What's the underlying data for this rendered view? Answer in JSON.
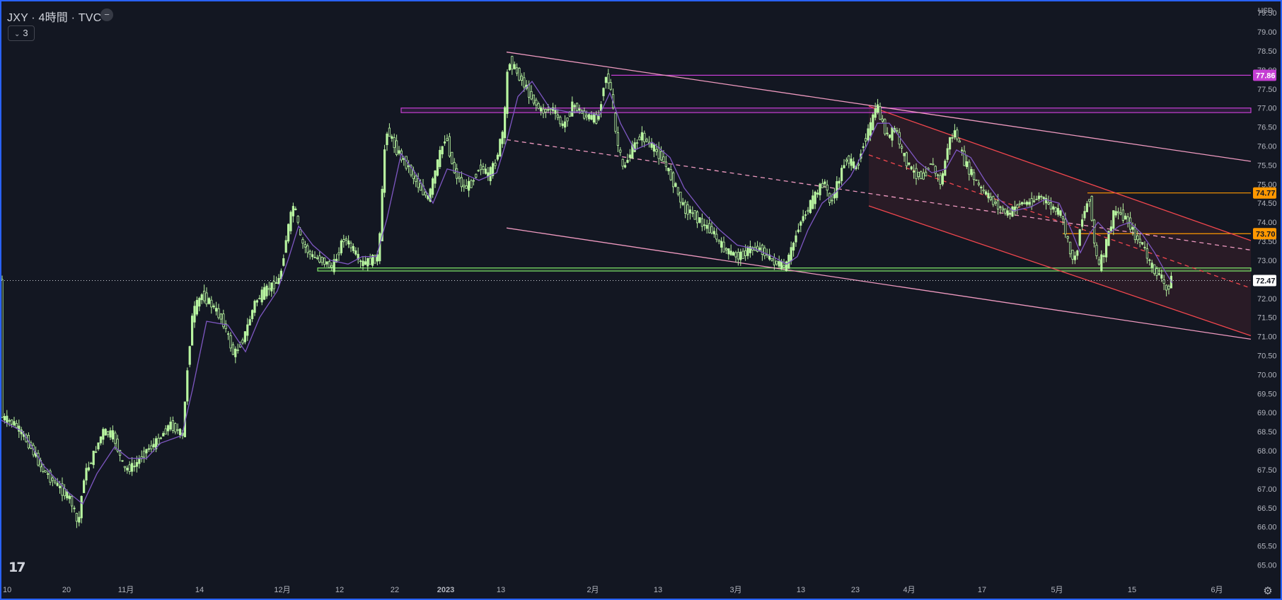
{
  "legend": {
    "title": "JXY · 4時間 · TVC",
    "toggle_icon": "minus-icon",
    "indicator_count": "3"
  },
  "currency": "USD",
  "colors": {
    "background": "#131722",
    "up": "#b8f5a0",
    "down": "#b8f5a0",
    "ma": "#7e57c2",
    "channel_outer": "#ef9ac0",
    "channel_red": "#f0464d",
    "resistance": "#c53ed3",
    "support": "#7be067",
    "level_orange": "#ff9800"
  },
  "chart_data": {
    "type": "candlestick",
    "title": "",
    "xlabel": "",
    "ylabel": "",
    "ylim": [
      64.6,
      79.8
    ],
    "y_ticks": [
      "79.50",
      "79.00",
      "78.50",
      "78.00",
      "77.50",
      "77.00",
      "76.50",
      "76.00",
      "75.50",
      "75.00",
      "74.50",
      "74.00",
      "73.50",
      "73.00",
      "72.50",
      "72.00",
      "71.50",
      "71.00",
      "70.50",
      "70.00",
      "69.50",
      "69.00",
      "68.50",
      "68.00",
      "67.50",
      "67.00",
      "66.50",
      "66.00",
      "65.50",
      "65.00"
    ],
    "x_ticks": [
      {
        "label": "10",
        "t": 2
      },
      {
        "label": "20",
        "t": 92
      },
      {
        "label": "11月",
        "t": 176
      },
      {
        "label": "14",
        "t": 280
      },
      {
        "label": "12月",
        "t": 397
      },
      {
        "label": "12",
        "t": 478
      },
      {
        "label": "22",
        "t": 556
      },
      {
        "label": "2023",
        "t": 628
      },
      {
        "label": "13",
        "t": 706
      },
      {
        "label": "2月",
        "t": 836
      },
      {
        "label": "13",
        "t": 928
      },
      {
        "label": "3月",
        "t": 1038
      },
      {
        "label": "13",
        "t": 1130
      },
      {
        "label": "23",
        "t": 1207
      },
      {
        "label": "4月",
        "t": 1283
      },
      {
        "label": "17",
        "t": 1386
      },
      {
        "label": "5月",
        "t": 1492
      },
      {
        "label": "15",
        "t": 1598
      },
      {
        "label": "6月",
        "t": 1718
      }
    ],
    "x_max": 1766,
    "last_bar_t": 1655,
    "series": [
      {
        "name": "price",
        "values": [
          [
            0,
            68.9
          ],
          [
            20,
            68.7
          ],
          [
            40,
            68.2
          ],
          [
            60,
            67.5
          ],
          [
            80,
            67.1
          ],
          [
            100,
            66.7
          ],
          [
            110,
            66.0
          ],
          [
            118,
            67.3
          ],
          [
            130,
            67.8
          ],
          [
            145,
            68.5
          ],
          [
            160,
            68.4
          ],
          [
            175,
            67.5
          ],
          [
            190,
            67.6
          ],
          [
            205,
            68.0
          ],
          [
            220,
            68.2
          ],
          [
            240,
            68.7
          ],
          [
            258,
            68.4
          ],
          [
            265,
            70.3
          ],
          [
            272,
            71.6
          ],
          [
            285,
            72.1
          ],
          [
            300,
            71.8
          ],
          [
            315,
            71.4
          ],
          [
            330,
            70.5
          ],
          [
            345,
            71.0
          ],
          [
            360,
            71.9
          ],
          [
            375,
            72.2
          ],
          [
            395,
            72.5
          ],
          [
            405,
            73.7
          ],
          [
            415,
            74.5
          ],
          [
            425,
            73.5
          ],
          [
            440,
            73.1
          ],
          [
            455,
            73.0
          ],
          [
            470,
            72.8
          ],
          [
            485,
            73.6
          ],
          [
            498,
            73.3
          ],
          [
            510,
            72.9
          ],
          [
            525,
            73.0
          ],
          [
            535,
            73.1
          ],
          [
            545,
            76.5
          ],
          [
            560,
            75.9
          ],
          [
            575,
            75.5
          ],
          [
            590,
            75.0
          ],
          [
            605,
            74.6
          ],
          [
            620,
            75.7
          ],
          [
            630,
            76.3
          ],
          [
            640,
            75.4
          ],
          [
            655,
            74.9
          ],
          [
            665,
            75.0
          ],
          [
            678,
            75.5
          ],
          [
            690,
            75.2
          ],
          [
            700,
            75.6
          ],
          [
            712,
            76.5
          ],
          [
            718,
            78.3
          ],
          [
            735,
            77.8
          ],
          [
            750,
            77.3
          ],
          [
            765,
            76.9
          ],
          [
            780,
            77.0
          ],
          [
            795,
            76.5
          ],
          [
            810,
            77.1
          ],
          [
            825,
            76.8
          ],
          [
            845,
            76.7
          ],
          [
            855,
            77.9
          ],
          [
            862,
            77.6
          ],
          [
            870,
            76.3
          ],
          [
            880,
            75.4
          ],
          [
            890,
            75.8
          ],
          [
            905,
            76.3
          ],
          [
            920,
            76.0
          ],
          [
            935,
            75.7
          ],
          [
            945,
            75.3
          ],
          [
            955,
            74.9
          ],
          [
            965,
            74.4
          ],
          [
            980,
            74.2
          ],
          [
            995,
            73.9
          ],
          [
            1005,
            73.8
          ],
          [
            1018,
            73.4
          ],
          [
            1030,
            73.2
          ],
          [
            1045,
            73.1
          ],
          [
            1060,
            73.3
          ],
          [
            1075,
            73.3
          ],
          [
            1090,
            73.0
          ],
          [
            1100,
            72.9
          ],
          [
            1110,
            72.8
          ],
          [
            1122,
            73.5
          ],
          [
            1130,
            74.0
          ],
          [
            1140,
            74.3
          ],
          [
            1155,
            74.8
          ],
          [
            1165,
            75.1
          ],
          [
            1172,
            74.5
          ],
          [
            1180,
            74.8
          ],
          [
            1195,
            75.7
          ],
          [
            1210,
            75.4
          ],
          [
            1220,
            76.1
          ],
          [
            1232,
            76.6
          ],
          [
            1238,
            77.1
          ],
          [
            1245,
            76.7
          ],
          [
            1255,
            76.2
          ],
          [
            1265,
            76.5
          ],
          [
            1275,
            75.8
          ],
          [
            1290,
            75.3
          ],
          [
            1305,
            75.2
          ],
          [
            1315,
            75.6
          ],
          [
            1322,
            75.3
          ],
          [
            1330,
            75.0
          ],
          [
            1340,
            76.1
          ],
          [
            1350,
            76.4
          ],
          [
            1362,
            75.6
          ],
          [
            1375,
            75.2
          ],
          [
            1385,
            74.9
          ],
          [
            1400,
            74.6
          ],
          [
            1412,
            74.4
          ],
          [
            1425,
            74.2
          ],
          [
            1440,
            74.5
          ],
          [
            1455,
            74.5
          ],
          [
            1470,
            74.7
          ],
          [
            1485,
            74.4
          ],
          [
            1500,
            74.2
          ],
          [
            1512,
            73.2
          ],
          [
            1520,
            73.0
          ],
          [
            1527,
            74.0
          ],
          [
            1533,
            74.3
          ],
          [
            1540,
            74.7
          ],
          [
            1545,
            73.6
          ],
          [
            1552,
            72.8
          ],
          [
            1560,
            73.2
          ],
          [
            1568,
            73.8
          ],
          [
            1575,
            74.3
          ],
          [
            1585,
            74.2
          ],
          [
            1595,
            74.0
          ],
          [
            1605,
            73.6
          ],
          [
            1615,
            73.4
          ],
          [
            1625,
            72.9
          ],
          [
            1632,
            72.7
          ],
          [
            1640,
            72.6
          ],
          [
            1648,
            72.2
          ],
          [
            1655,
            72.5
          ]
        ]
      },
      {
        "name": "ma",
        "values": [
          [
            0,
            68.8
          ],
          [
            30,
            68.5
          ],
          [
            60,
            67.6
          ],
          [
            95,
            66.9
          ],
          [
            115,
            66.6
          ],
          [
            135,
            67.4
          ],
          [
            160,
            68.1
          ],
          [
            180,
            67.8
          ],
          [
            205,
            67.8
          ],
          [
            225,
            68.2
          ],
          [
            255,
            68.4
          ],
          [
            270,
            69.6
          ],
          [
            290,
            71.4
          ],
          [
            320,
            71.3
          ],
          [
            345,
            70.6
          ],
          [
            365,
            71.5
          ],
          [
            390,
            72.2
          ],
          [
            405,
            73.0
          ],
          [
            420,
            73.9
          ],
          [
            440,
            73.4
          ],
          [
            465,
            73.0
          ],
          [
            490,
            72.9
          ],
          [
            510,
            73.1
          ],
          [
            530,
            73.1
          ],
          [
            545,
            74.1
          ],
          [
            565,
            75.8
          ],
          [
            585,
            75.3
          ],
          [
            610,
            74.5
          ],
          [
            630,
            75.4
          ],
          [
            650,
            75.3
          ],
          [
            675,
            75.1
          ],
          [
            700,
            75.3
          ],
          [
            715,
            76.2
          ],
          [
            730,
            77.3
          ],
          [
            750,
            77.7
          ],
          [
            775,
            77.0
          ],
          [
            800,
            76.9
          ],
          [
            825,
            76.9
          ],
          [
            845,
            76.8
          ],
          [
            860,
            77.4
          ],
          [
            875,
            76.6
          ],
          [
            895,
            75.9
          ],
          [
            920,
            76.1
          ],
          [
            945,
            75.7
          ],
          [
            965,
            74.9
          ],
          [
            990,
            74.3
          ],
          [
            1015,
            73.8
          ],
          [
            1040,
            73.4
          ],
          [
            1065,
            73.3
          ],
          [
            1090,
            73.1
          ],
          [
            1110,
            72.9
          ],
          [
            1125,
            73.1
          ],
          [
            1140,
            73.8
          ],
          [
            1160,
            74.5
          ],
          [
            1180,
            74.8
          ],
          [
            1200,
            75.2
          ],
          [
            1220,
            75.9
          ],
          [
            1238,
            76.6
          ],
          [
            1255,
            76.6
          ],
          [
            1275,
            76.1
          ],
          [
            1295,
            75.6
          ],
          [
            1315,
            75.3
          ],
          [
            1335,
            75.4
          ],
          [
            1350,
            75.9
          ],
          [
            1370,
            75.7
          ],
          [
            1390,
            75.1
          ],
          [
            1410,
            74.6
          ],
          [
            1430,
            74.3
          ],
          [
            1455,
            74.4
          ],
          [
            1475,
            74.6
          ],
          [
            1495,
            74.5
          ],
          [
            1512,
            73.8
          ],
          [
            1525,
            73.2
          ],
          [
            1538,
            73.7
          ],
          [
            1550,
            74.0
          ],
          [
            1565,
            73.7
          ],
          [
            1580,
            73.9
          ],
          [
            1595,
            74.0
          ],
          [
            1612,
            73.7
          ],
          [
            1630,
            73.2
          ],
          [
            1645,
            72.7
          ],
          [
            1655,
            72.4
          ]
        ]
      }
    ],
    "horizontal_levels": [
      {
        "name": "resistance-high",
        "value": 77.86,
        "label": "77.86",
        "color": "#c53ed3",
        "t_start": 862
      },
      {
        "name": "resistance-zone",
        "value": 77.0,
        "value2": 76.88,
        "color": "#c53ed3",
        "t_start": 565
      },
      {
        "name": "orange-upper",
        "value": 74.77,
        "label": "74.77",
        "color": "#ff9800",
        "t_start": 1535
      },
      {
        "name": "orange-lower",
        "value": 73.7,
        "label": "73.70",
        "color": "#ff9800",
        "t_start": 1500
      },
      {
        "name": "support-zone",
        "value": 72.8,
        "value2": 72.72,
        "color": "#7be067",
        "t_start": 447
      }
    ],
    "trend_lines": [
      {
        "name": "outer-upper",
        "t": [
          714,
          1766
        ],
        "v": [
          78.47,
          75.6
        ],
        "dash": false,
        "color": "#ef9ac0"
      },
      {
        "name": "outer-middle",
        "t": [
          714,
          1766
        ],
        "v": [
          76.17,
          73.27
        ],
        "dash": true,
        "color": "#ef9ac0"
      },
      {
        "name": "outer-lower",
        "t": [
          714,
          1766
        ],
        "v": [
          73.85,
          70.93
        ],
        "dash": false,
        "color": "#ef9ac0"
      },
      {
        "name": "red-upper",
        "t": [
          1226,
          1766
        ],
        "v": [
          77.05,
          73.52
        ],
        "dash": false,
        "color": "#f0464d"
      },
      {
        "name": "red-middle",
        "t": [
          1226,
          1766
        ],
        "v": [
          75.77,
          72.27
        ],
        "dash": true,
        "color": "#f0464d"
      },
      {
        "name": "red-lower",
        "t": [
          1226,
          1766
        ],
        "v": [
          74.43,
          71.02
        ],
        "dash": false,
        "color": "#f0464d"
      }
    ],
    "current_price": {
      "value": 72.47,
      "label": "72.47"
    },
    "grid": false,
    "legend": "top-left"
  },
  "settings_icon": "gear-icon",
  "logo_icon": "tradingview-logo-icon",
  "logo_text": "17"
}
